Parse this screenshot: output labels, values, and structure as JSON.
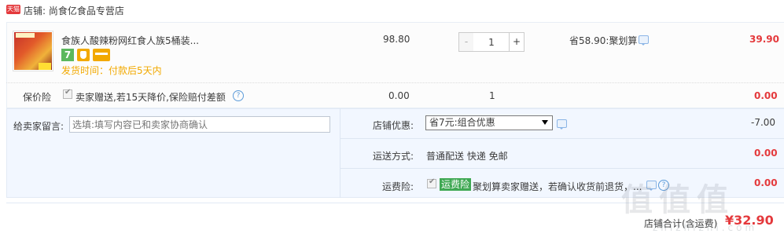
{
  "shop": {
    "badge": "天猫",
    "label": "店铺: 尚食亿食品专营店"
  },
  "item": {
    "title": "食族人酸辣粉网红食人族5桶装...",
    "icon_7": "7",
    "ship_time": "发货时间：付款后5天内",
    "unit_price": "98.80",
    "quantity": "1",
    "minus_label": "-",
    "plus_label": "+",
    "discount": "省58.90:聚划算",
    "total": "39.90"
  },
  "insurance": {
    "label": "保价险",
    "text": "卖家赠送,若15天降价,保险赔付差额",
    "help": "?",
    "price": "0.00",
    "qty": "1",
    "total": "0.00"
  },
  "note": {
    "label": "给卖家留言:",
    "placeholder": "选填:填写内容已和卖家协商确认"
  },
  "promo": {
    "label": "店铺优惠:",
    "selected": "省7元:组合优惠",
    "value": "-7.00"
  },
  "shipping": {
    "label": "运送方式:",
    "value": "普通配送 快递 免邮",
    "total": "0.00"
  },
  "return_insurance": {
    "label": "运费险:",
    "tag": "运费险",
    "text": "聚划算卖家赠送，若确认收货前退货，...",
    "help": "?",
    "total": "0.00"
  },
  "footer": {
    "label": "店铺合计(含运费)",
    "total": "¥32.90"
  },
  "watermark": {
    "text": "值值值",
    "url": "zhizhizhi.com"
  },
  "colors": {
    "price_red": "#e4393c",
    "ship_orange": "#f2a900",
    "panel_blue": "#f2f7ff",
    "tag_green": "#3fa853"
  }
}
